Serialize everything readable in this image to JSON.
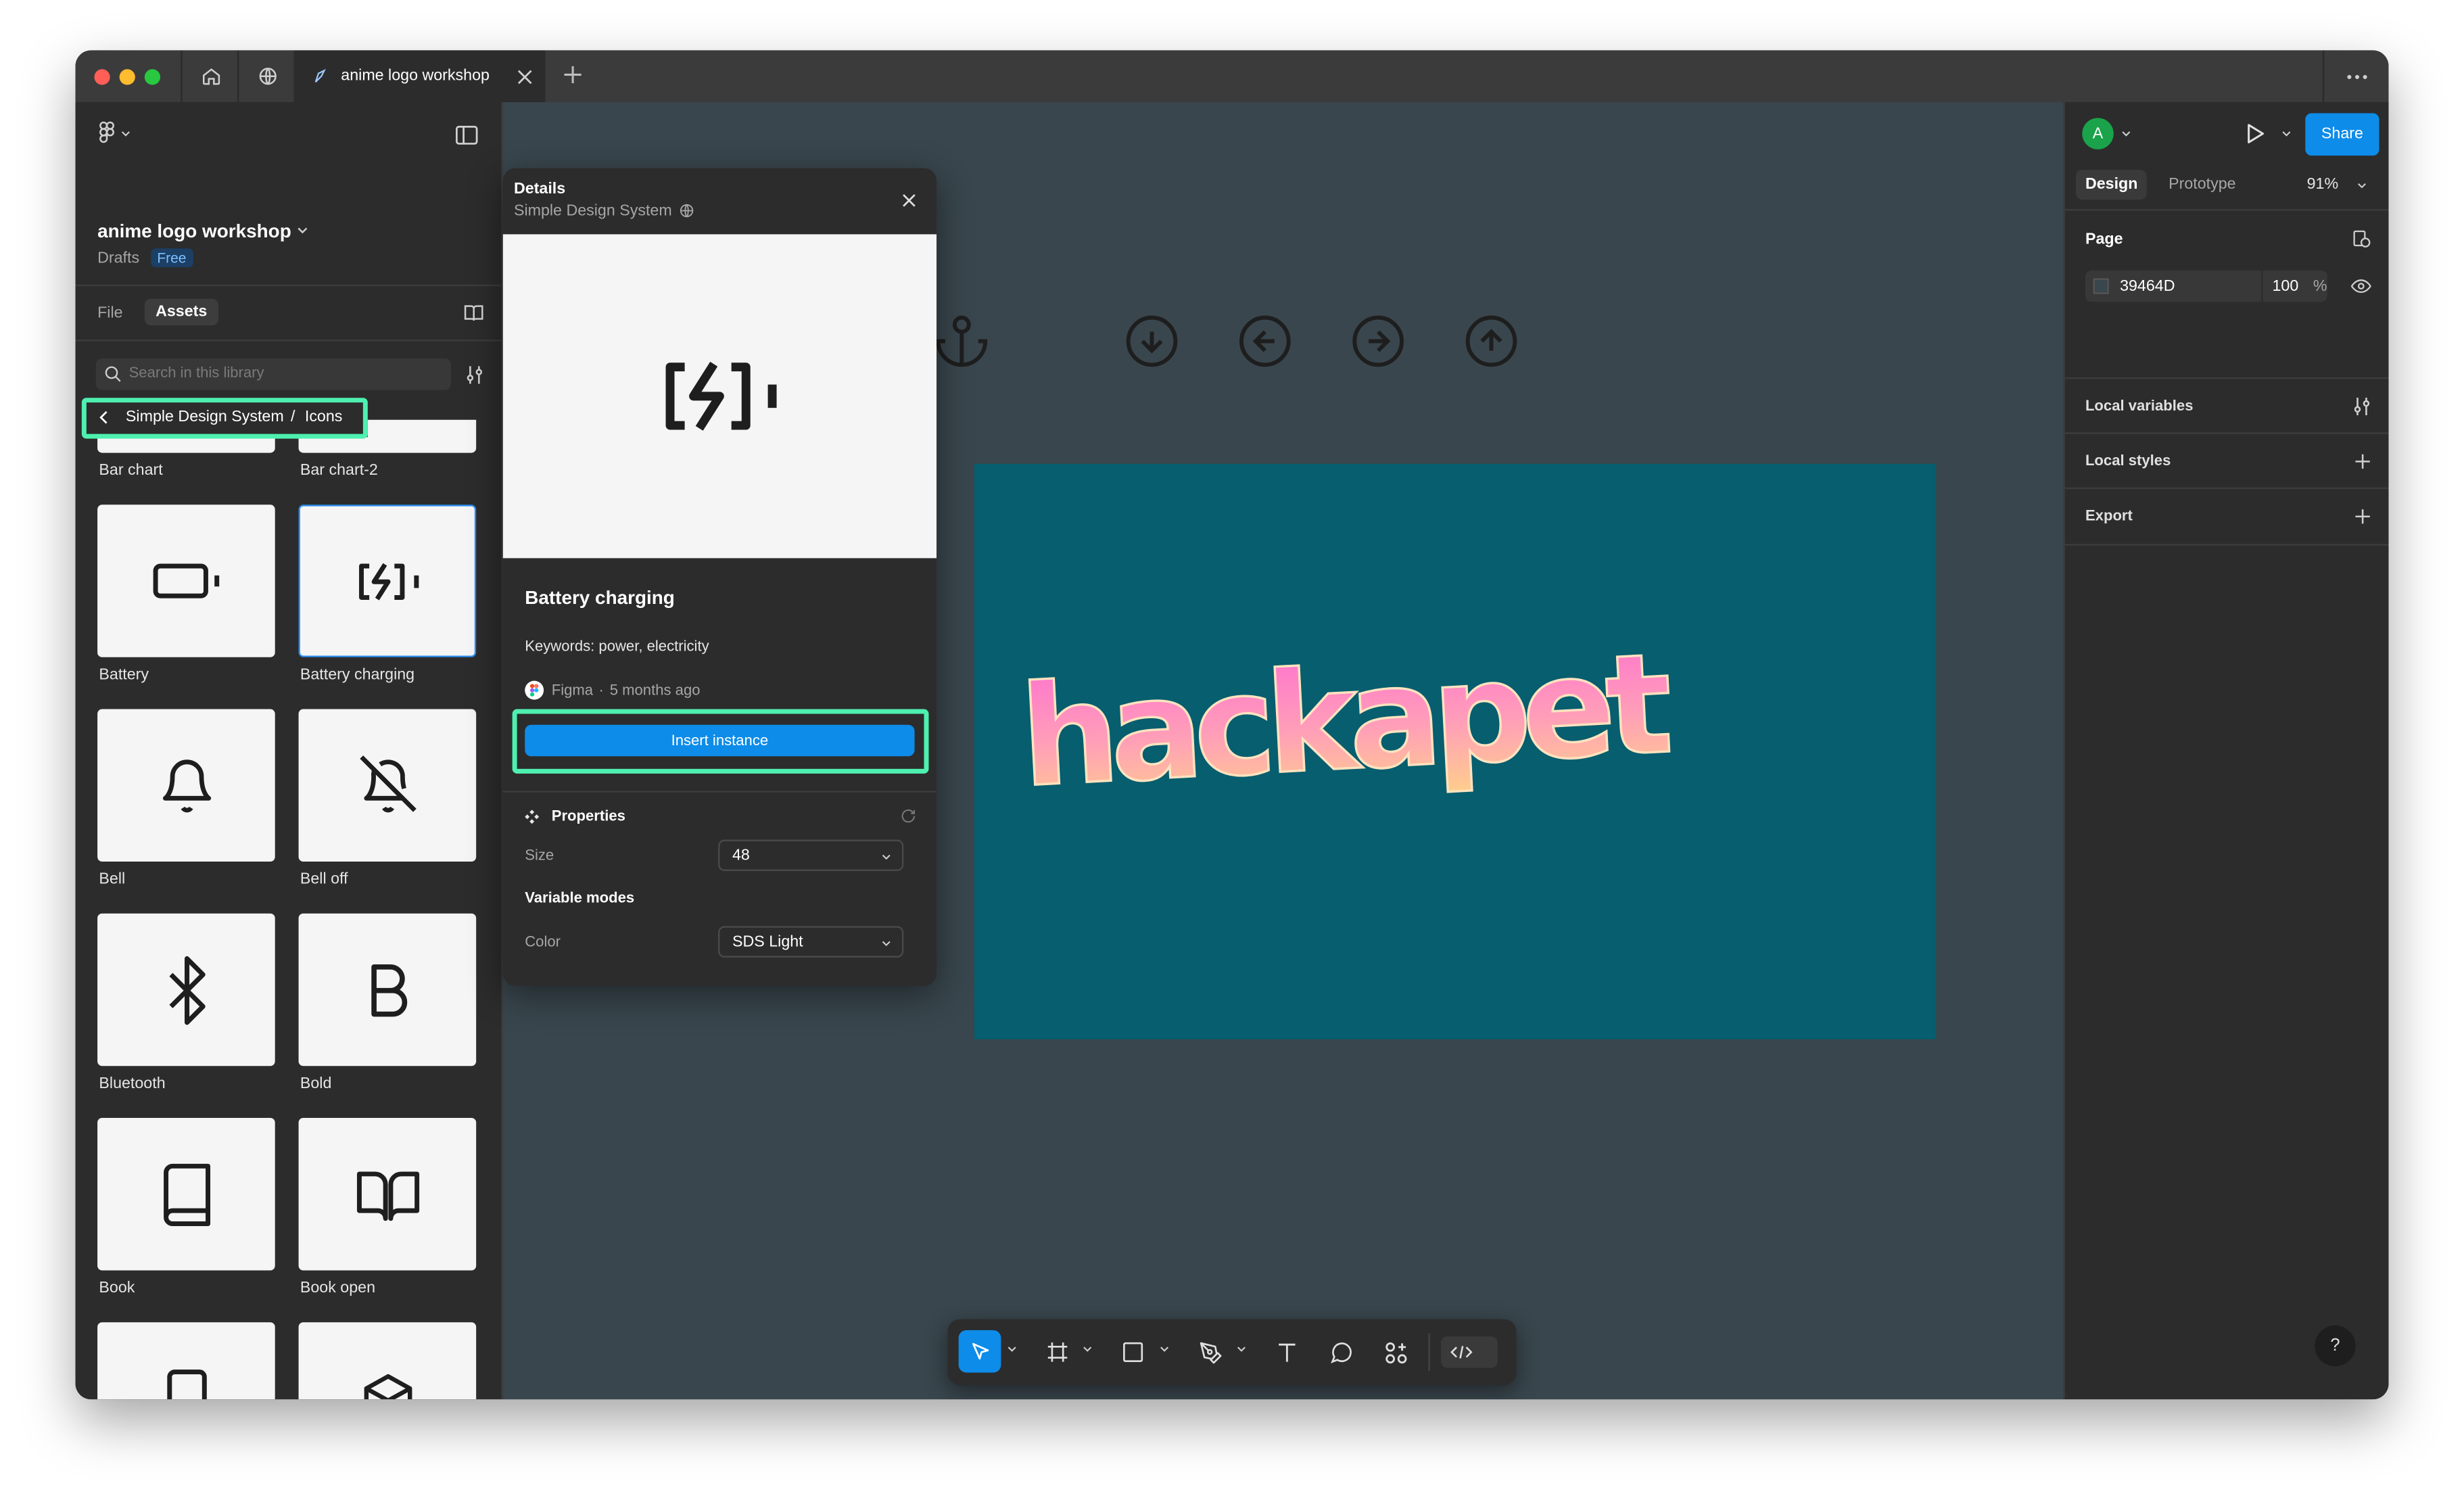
{
  "browser": {
    "tab_title": "anime logo workshop",
    "more_icon": "more-horizontal-icon",
    "home_icon": "home-icon",
    "globe_icon": "globe-icon"
  },
  "file": {
    "name": "anime logo workshop",
    "location": "Drafts",
    "plan_badge": "Free"
  },
  "left_panel": {
    "tabs": [
      "File",
      "Assets"
    ],
    "active_tab": "Assets",
    "search_placeholder": "Search in this library",
    "breadcrumb_library": "Simple Design System",
    "breadcrumb_separator": "/",
    "breadcrumb_folder": "Icons",
    "assets": [
      {
        "label": "Bar chart",
        "icon": "bar-chart-icon"
      },
      {
        "label": "Bar chart-2",
        "icon": "bar-chart-2-icon"
      },
      {
        "label": "Battery",
        "icon": "battery-icon"
      },
      {
        "label": "Battery charging",
        "icon": "battery-charging-icon"
      },
      {
        "label": "Bell",
        "icon": "bell-icon"
      },
      {
        "label": "Bell off",
        "icon": "bell-off-icon"
      },
      {
        "label": "Bluetooth",
        "icon": "bluetooth-icon"
      },
      {
        "label": "Bold",
        "icon": "bold-icon"
      },
      {
        "label": "Book",
        "icon": "book-icon"
      },
      {
        "label": "Book open",
        "icon": "book-open-icon"
      },
      {
        "label": "",
        "icon": "bookmark-icon"
      },
      {
        "label": "",
        "icon": "box-icon"
      }
    ]
  },
  "details": {
    "header": "Details",
    "library": "Simple Design System",
    "component_name": "Battery charging",
    "keywords": "Keywords: power, electricity",
    "author": "Figma",
    "meta_separator": "·",
    "updated": "5 months ago",
    "insert_button": "Insert instance",
    "properties_label": "Properties",
    "size_label": "Size",
    "size_value": "48",
    "variable_modes_label": "Variable modes",
    "color_label": "Color",
    "color_value": "SDS Light"
  },
  "canvas": {
    "background": "#39464D",
    "frame_color": "#065E6E",
    "logo_text": "hackapet",
    "icon_row": [
      "anchor-icon",
      "arrow-down-circle-icon",
      "arrow-left-circle-icon",
      "arrow-right-circle-icon",
      "arrow-up-circle-icon"
    ]
  },
  "right_panel": {
    "avatar_letter": "A",
    "share_label": "Share",
    "tabs": [
      "Design",
      "Prototype"
    ],
    "active_tab": "Design",
    "zoom": "91%",
    "page_label": "Page",
    "page_color_hex": "39464D",
    "page_opacity": "100",
    "percent_sign": "%",
    "local_variables": "Local variables",
    "local_styles": "Local styles",
    "export": "Export",
    "help": "?"
  },
  "colors": {
    "accent_blue": "#0d8ce9",
    "highlight_green": "#4ef0b0",
    "avatar_green": "#1aa34a"
  }
}
